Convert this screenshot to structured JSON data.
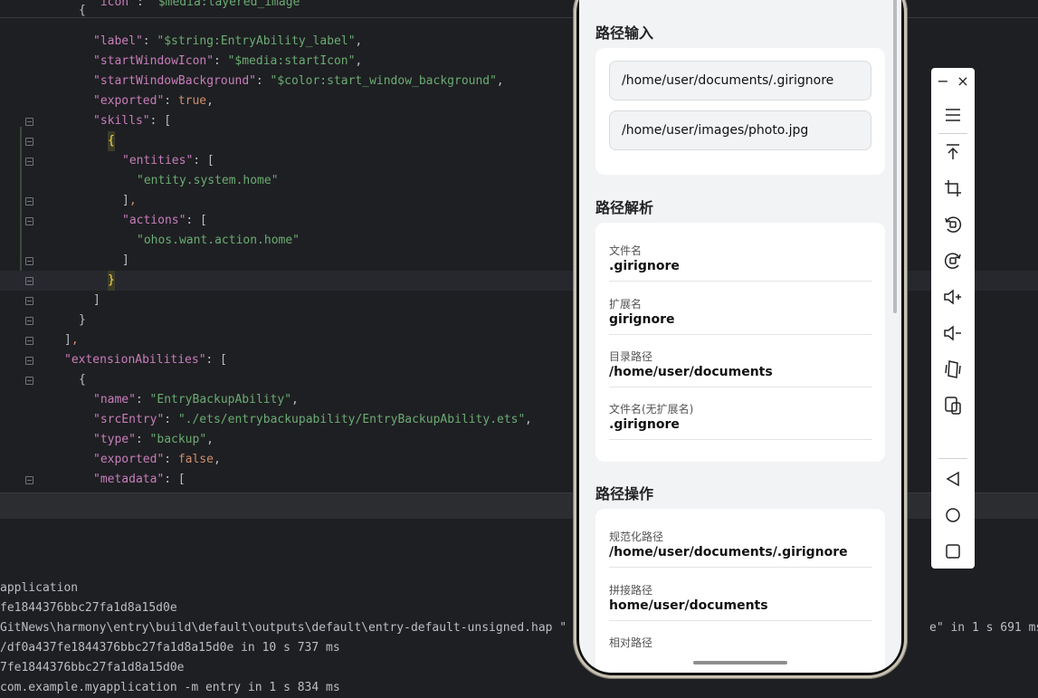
{
  "editor": {
    "line_partial_top": {
      "key": "\"icon\"",
      "value": "\"$media:layered_image\""
    },
    "lines": [
      {
        "indent": 0,
        "text": "{"
      },
      {
        "key": "\"label\"",
        "value": "\"$string:EntryAbility_label\"",
        "tail": ","
      },
      {
        "key": "\"startWindowIcon\"",
        "value": "\"$media:startIcon\"",
        "tail": ","
      },
      {
        "key": "\"startWindowBackground\"",
        "value": "\"$color:start_window_background\"",
        "tail": ","
      },
      {
        "key": "\"exported\"",
        "kw": "true",
        "tail": ","
      },
      {
        "key": "\"skills\"",
        "tail": ": ["
      },
      {
        "brace": "{"
      },
      {
        "key": "\"entities\"",
        "tail": ": ["
      },
      {
        "str": "\"entity.system.home\""
      },
      {
        "text": "],"
      },
      {
        "key": "\"actions\"",
        "tail": ": ["
      },
      {
        "str": "\"ohos.want.action.home\""
      },
      {
        "text": "]"
      },
      {
        "brace": "}"
      },
      {
        "text": "]"
      },
      {
        "text": "}"
      },
      {
        "text": "],"
      },
      {
        "key": "\"extensionAbilities\"",
        "tail": ": ["
      },
      {
        "text": "{"
      },
      {
        "key": "\"name\"",
        "value": "\"EntryBackupAbility\"",
        "tail": ","
      },
      {
        "key": "\"srcEntry\"",
        "value": "\"./ets/entrybackupability/EntryBackupAbility.ets\"",
        "tail": ","
      },
      {
        "key": "\"type\"",
        "value": "\"backup\"",
        "tail": ","
      },
      {
        "key": "\"exported\"",
        "kw": "false",
        "tail": ","
      },
      {
        "key": "\"metadata\"",
        "tail": ": ["
      }
    ]
  },
  "console": {
    "lines": [
      "application",
      "fe1844376bbc27fa1d8a15d0e",
      "GitNews\\harmony\\entry\\build\\default\\outputs\\default\\entry-default-unsigned.hap \"",
      "/df0a437fe1844376bbc27fa1d8a15d0e in 10 s 737 ms",
      "7fe1844376bbc27fa1d8a15d0e",
      "com.example.myapplication -m entry in 1 s 834 ms"
    ],
    "right_fragment": "e\" in 1 s 691 ms"
  },
  "app": {
    "section_input": "路径输入",
    "input_1": "/home/user/documents/.girignore",
    "input_2": "/home/user/images/photo.jpg",
    "section_parse": "路径解析",
    "parse": [
      {
        "label": "文件名",
        "value": ".girignore"
      },
      {
        "label": "扩展名",
        "value": "girignore"
      },
      {
        "label": "目录路径",
        "value": "/home/user/documents"
      },
      {
        "label": "文件名(无扩展名)",
        "value": ".girignore"
      }
    ],
    "section_ops": "路径操作",
    "ops": [
      {
        "label": "规范化路径",
        "value": "/home/user/documents/.girignore"
      },
      {
        "label": "拼接路径",
        "value": "home/user/documents"
      },
      {
        "label": "相对路径",
        "value": ""
      }
    ]
  },
  "toolbar": {
    "minimize": "−",
    "close": "×",
    "icons": [
      "menu-icon",
      "pin-top-icon",
      "crop-icon",
      "rotate-left-icon",
      "rotate-right-icon",
      "volume-up-icon",
      "volume-down-icon",
      "fold-icon",
      "multi-device-icon",
      "back-icon",
      "home-icon",
      "recent-icon"
    ]
  }
}
